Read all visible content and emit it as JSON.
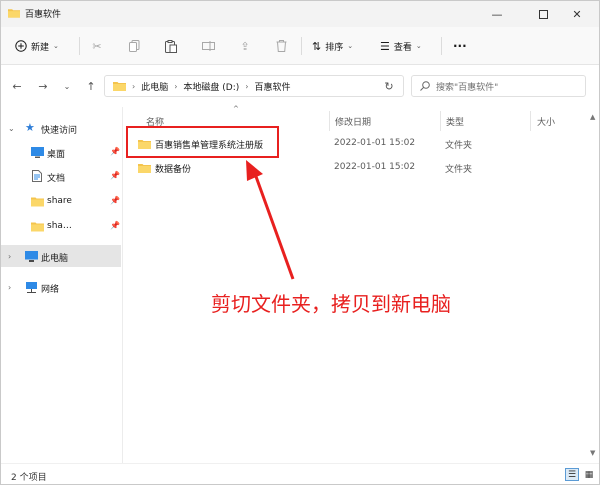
{
  "window": {
    "title": "百惠软件",
    "controls": [
      "minimize-icon",
      "maximize-icon",
      "close-icon"
    ]
  },
  "toolbar": {
    "new_label": "新建",
    "sort_label": "排序",
    "view_label": "查看",
    "more_label": "···",
    "icons": [
      "cut-icon",
      "copy-icon",
      "paste-icon",
      "rename-icon",
      "share-icon",
      "delete-icon"
    ]
  },
  "address": {
    "breadcrumb": [
      "此电脑",
      "本地磁盘 (D:)",
      "百惠软件"
    ]
  },
  "search": {
    "placeholder": "搜索\"百惠软件\""
  },
  "sidebar": {
    "items": [
      {
        "label": "快速访问",
        "icon": "star-icon"
      },
      {
        "label": "桌面",
        "icon": "desktop-icon"
      },
      {
        "label": "文档",
        "icon": "document-icon"
      },
      {
        "label": "share",
        "icon": "folder-icon"
      },
      {
        "label": "sha…",
        "icon": "folder-icon"
      },
      {
        "label": "此电脑",
        "icon": "computer-icon"
      },
      {
        "label": "网络",
        "icon": "network-icon"
      }
    ]
  },
  "columns": {
    "name": "名称",
    "date": "修改日期",
    "type": "类型",
    "size": "大小"
  },
  "files": [
    {
      "name": "百惠销售单管理系统注册版",
      "date": "2022-01-01 15:02",
      "type": "文件夹"
    },
    {
      "name": "数据备份",
      "date": "2022-01-01 15:02",
      "type": "文件夹"
    }
  ],
  "annotation": {
    "text": "剪切文件夹，拷贝到新电脑"
  },
  "status": {
    "count_text": "2 个项目"
  },
  "colors": {
    "accent": "#0067c0",
    "folder": "#f4c44d",
    "annotation_red": "#e8201f",
    "selected_bg": "#e5e5e5"
  }
}
